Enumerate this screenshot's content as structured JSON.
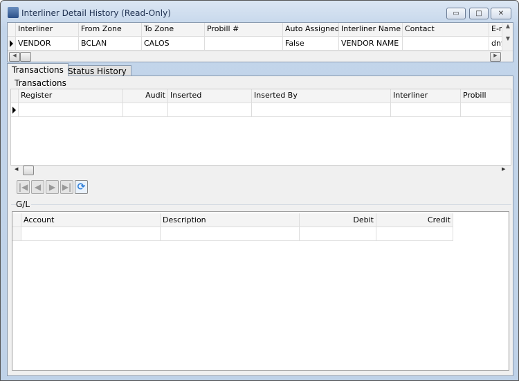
{
  "window": {
    "title": "Interliner Detail History (Read-Only)",
    "minimize": "▭",
    "maximize": "□",
    "close": "✕"
  },
  "top_grid": {
    "columns": [
      "Interliner",
      "From Zone",
      "To Zone",
      "Probill #",
      "Auto Assigned",
      "Interliner Name",
      "Contact",
      "E-m"
    ],
    "rows": [
      [
        "VENDOR",
        "BCLAN",
        "CALOS",
        "",
        "False",
        "VENDOR NAME",
        "",
        "dny"
      ]
    ]
  },
  "tabs": [
    {
      "label": "Transactions",
      "active": true
    },
    {
      "label": "Status History",
      "active": false
    }
  ],
  "transactions": {
    "group_label": "Transactions",
    "columns": [
      "Register",
      "Audit",
      "Inserted",
      "Inserted By",
      "Interliner",
      "Probill"
    ]
  },
  "navigator": {
    "first": "|◀",
    "prev": "◀",
    "next": "▶",
    "last": "▶|",
    "refresh": "⟳"
  },
  "gl": {
    "group_label": "G/L",
    "columns": [
      "Account",
      "Description",
      "Debit",
      "Credit"
    ]
  }
}
